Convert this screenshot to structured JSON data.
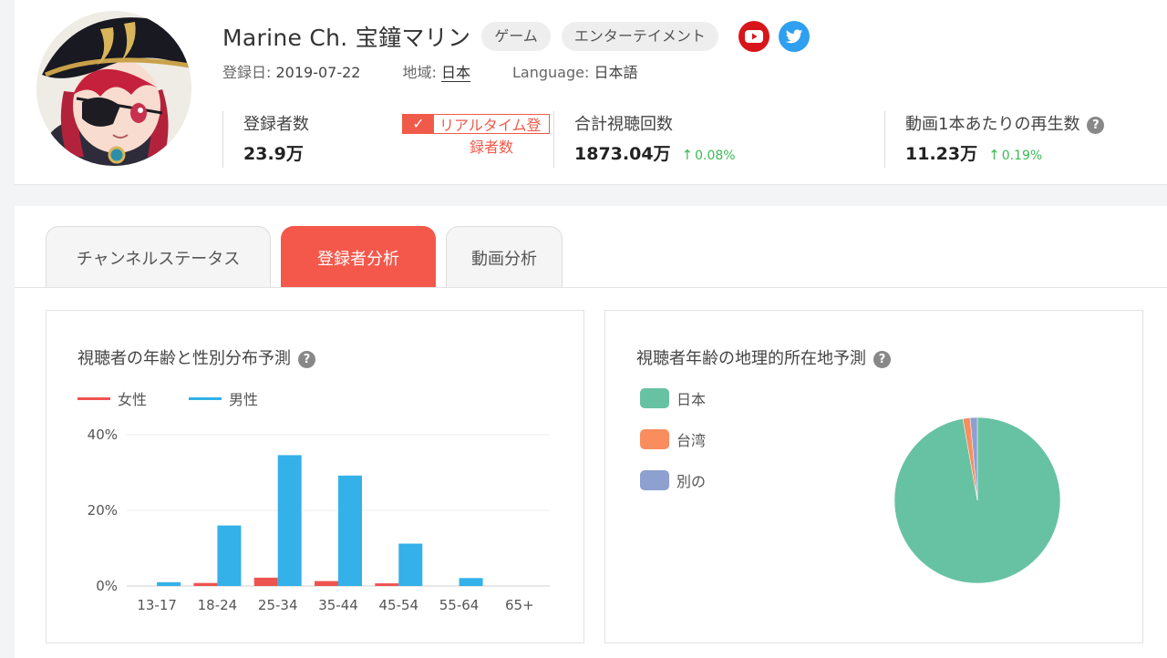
{
  "channel": {
    "name": "Marine Ch. 宝鐘マリン",
    "tags": [
      "ゲーム",
      "エンターテイメント"
    ],
    "registered_label": "登録日:",
    "registered_value": "2019-07-22",
    "region_label": "地域:",
    "region_value": "日本",
    "language_label": "Language:",
    "language_value": "日本語"
  },
  "stats": {
    "subscribers_label": "登録者数",
    "subscribers_value": "23.9万",
    "realtime_label_1": "リアルタイム登",
    "realtime_label_2": "録者数",
    "views_label": "合計視聴回数",
    "views_value": "1873.04万",
    "views_delta": "0.08%",
    "per_video_label": "動画1本あたりの再生数",
    "per_video_value": "11.23万",
    "per_video_delta": "0.19%"
  },
  "tabs": [
    "チャンネルステータス",
    "登録者分析",
    "動画分析"
  ],
  "age_chart": {
    "title": "視聴者の年齢と性別分布予測"
  },
  "geo_chart": {
    "title": "視聴者年齢の地理的所在地予測"
  },
  "chart_data": [
    {
      "type": "bar",
      "title": "視聴者の年齢と性別分布予測",
      "categories": [
        "13-17",
        "18-24",
        "25-34",
        "35-44",
        "45-54",
        "55-64",
        "65+"
      ],
      "series": [
        {
          "name": "女性",
          "color": "#ef5350",
          "values": [
            0,
            0.8,
            2.2,
            1.3,
            0.7,
            0,
            0
          ]
        },
        {
          "name": "男性",
          "color": "#33b1e8",
          "values": [
            1.0,
            16.0,
            34.6,
            29.2,
            11.2,
            2.1,
            0
          ]
        }
      ],
      "yticks": [
        "0%",
        "20%",
        "40%"
      ],
      "ylim": [
        0,
        40
      ],
      "legend": "top-left",
      "grid": true
    },
    {
      "type": "pie",
      "title": "視聴者年齢の地理的所在地予測",
      "labels": [
        "日本",
        "台湾",
        "別の"
      ],
      "values": [
        97.2,
        1.4,
        1.4
      ],
      "colors": [
        "#67c2a4",
        "#f98d5e",
        "#8ea0cf"
      ],
      "legend": "left"
    }
  ],
  "colors": {
    "accent": "#f4584b",
    "up": "#3cba54"
  }
}
